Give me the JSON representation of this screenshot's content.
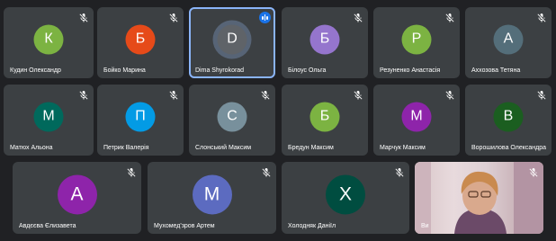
{
  "participants": [
    {
      "name": "Кудин Олександр",
      "initial": "К",
      "color": "#7cb342",
      "muted": true
    },
    {
      "name": "Бойко Марина",
      "initial": "Б",
      "color": "#e64a19",
      "muted": true
    },
    {
      "name": "Dima Shyrokorad",
      "initial": "D",
      "color": "#5f6368",
      "muted": false,
      "speaking": true
    },
    {
      "name": "Білоус Ольга",
      "initial": "Б",
      "color": "#9575cd",
      "muted": true
    },
    {
      "name": "Резуненко Анастасія",
      "initial": "Р",
      "color": "#7cb342",
      "muted": true
    },
    {
      "name": "Аххозова Тетяна",
      "initial": "А",
      "color": "#546e7a",
      "muted": true
    },
    {
      "name": "Матюх Альона",
      "initial": "М",
      "color": "#00695c",
      "muted": true
    },
    {
      "name": "Петрик Валерія",
      "initial": "П",
      "color": "#039be5",
      "muted": true
    },
    {
      "name": "Слонський Максим",
      "initial": "С",
      "color": "#78909c",
      "muted": true
    },
    {
      "name": "Бредун Максим",
      "initial": "Б",
      "color": "#7cb342",
      "muted": true
    },
    {
      "name": "Марчук Максим",
      "initial": "М",
      "color": "#8e24aa",
      "muted": true
    },
    {
      "name": "Ворошилова Олександра",
      "initial": "В",
      "color": "#1b5e20",
      "muted": true
    },
    {
      "name": "Авдєєва Єлизавета",
      "initial": "А",
      "color": "#8e24aa",
      "muted": true
    },
    {
      "name": "Мухомед'зров Артем",
      "initial": "М",
      "color": "#5c6bc0",
      "muted": true
    },
    {
      "name": "Холодняк Даніїл",
      "initial": "Х",
      "color": "#004d40",
      "muted": true
    },
    {
      "name": "Ви",
      "initial": "",
      "color": "",
      "muted": true,
      "video": true
    }
  ]
}
